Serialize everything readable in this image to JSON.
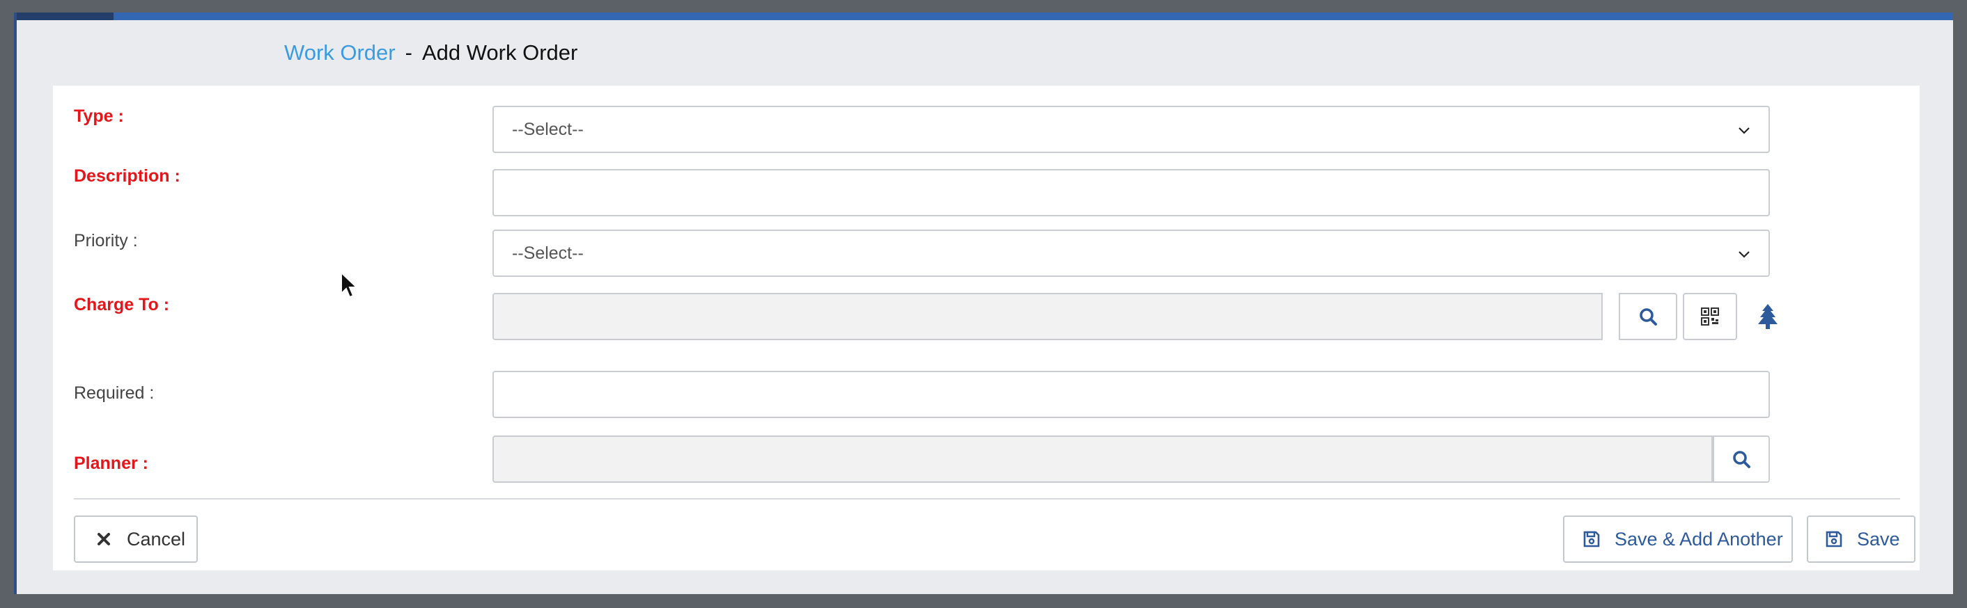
{
  "header": {
    "breadcrumb_link": "Work Order",
    "separator": "-",
    "title": "Add Work Order"
  },
  "form": {
    "type": {
      "label": "Type :",
      "required": true,
      "placeholder": "--Select--"
    },
    "description": {
      "label": "Description :",
      "required": true,
      "value": ""
    },
    "priority": {
      "label": "Priority :",
      "required": false,
      "placeholder": "--Select--"
    },
    "charge_to": {
      "label": "Charge To :",
      "required": true,
      "value": ""
    },
    "required_date": {
      "label": "Required :",
      "required": false,
      "value": ""
    },
    "planner": {
      "label": "Planner :",
      "required": true,
      "value": ""
    }
  },
  "actions": {
    "cancel": "Cancel",
    "save_add_another": "Save & Add Another",
    "save": "Save"
  },
  "icons": {
    "dropdown": "chevron-down-icon",
    "lookup": "search-icon",
    "scan": "qr-code-icon",
    "hierarchy": "tree-icon",
    "cancel": "times-icon",
    "save": "floppy-disk-icon",
    "pointer": "mouse-cursor-icon"
  },
  "colors": {
    "accent_bar": "#3366b3",
    "link": "#3b9be0",
    "required_label": "#e4161a",
    "icon_blue": "#2d5a9b",
    "action_text": "#2d5a9b"
  },
  "progress": {
    "top_bar_fraction": 0.05
  }
}
